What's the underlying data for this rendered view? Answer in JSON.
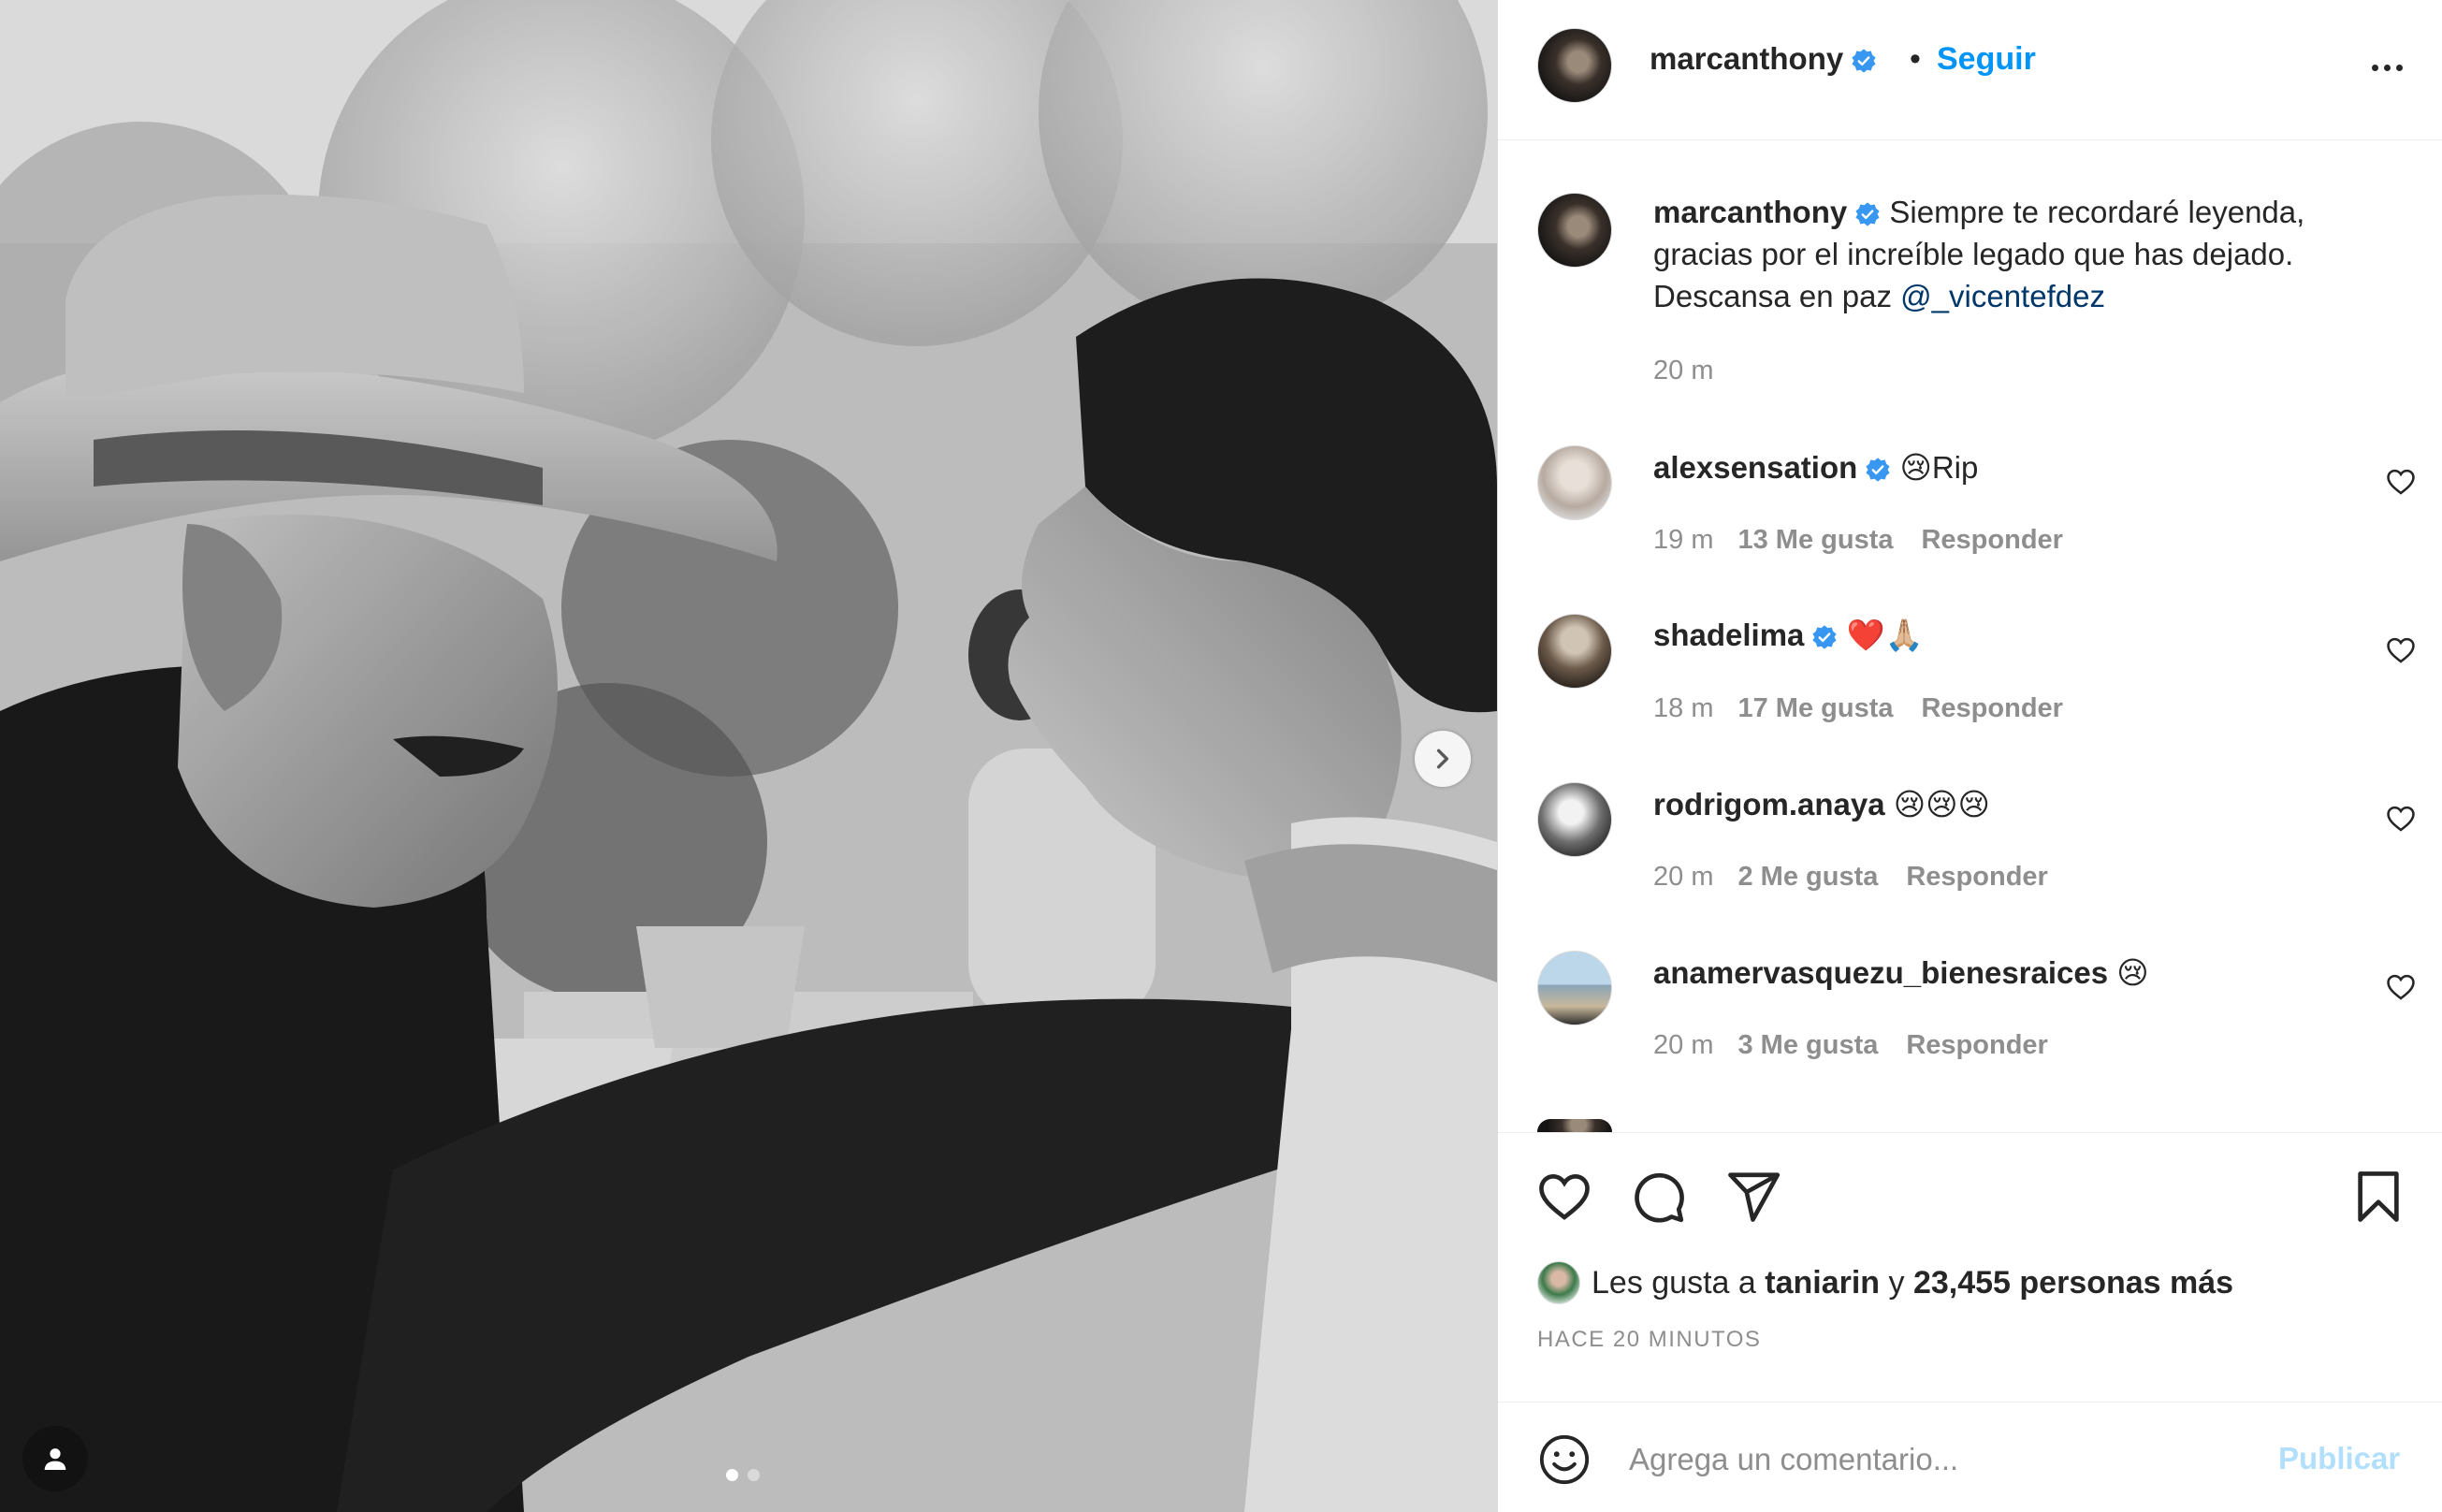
{
  "post": {
    "author": "marcanthony",
    "follow_label": "Seguir",
    "separator": "•",
    "caption": "Siempre te recordaré leyenda, gracias por el increíble legado que has dejado. Descansa en paz",
    "caption_mention": "@_vicentefdez",
    "caption_time": "20 m"
  },
  "comments": [
    {
      "user": "alexsensation",
      "verified": true,
      "text": "😢Rip",
      "time": "19 m",
      "likes": "13 Me gusta",
      "reply": "Responder"
    },
    {
      "user": "shadelima",
      "verified": true,
      "text": "❤️🙏🏼",
      "time": "18 m",
      "likes": "17 Me gusta",
      "reply": "Responder"
    },
    {
      "user": "rodrigom.anaya",
      "verified": false,
      "text": "😢😢😢",
      "time": "20 m",
      "likes": "2 Me gusta",
      "reply": "Responder"
    },
    {
      "user": "anamervasquezu_bienesraices",
      "verified": false,
      "text": "😢",
      "time": "20 m",
      "likes": "3 Me gusta",
      "reply": "Responder"
    }
  ],
  "likes_line": {
    "prefix": "Les gusta a",
    "user": "taniarin",
    "conj": "y",
    "others": "23,455 personas más"
  },
  "timeago": "HACE 20 MINUTOS",
  "comment_input": {
    "placeholder": "Agrega un comentario...",
    "publish_label": "Publicar"
  },
  "icons": {
    "verified": "verified-badge-icon",
    "heart": "heart-icon",
    "comment": "comment-icon",
    "share": "share-icon",
    "save": "bookmark-icon",
    "emoji": "emoji-icon",
    "next": "chevron-right-icon",
    "tag": "user-tag-icon",
    "more": "more-options-icon"
  },
  "colors": {
    "accent": "#0095f6",
    "verified": "#3897f0",
    "mention": "#00376b",
    "muted": "#8e8e8e",
    "publish_disabled": "#b2dffc"
  },
  "carousel": {
    "total": 2,
    "current": 1
  }
}
